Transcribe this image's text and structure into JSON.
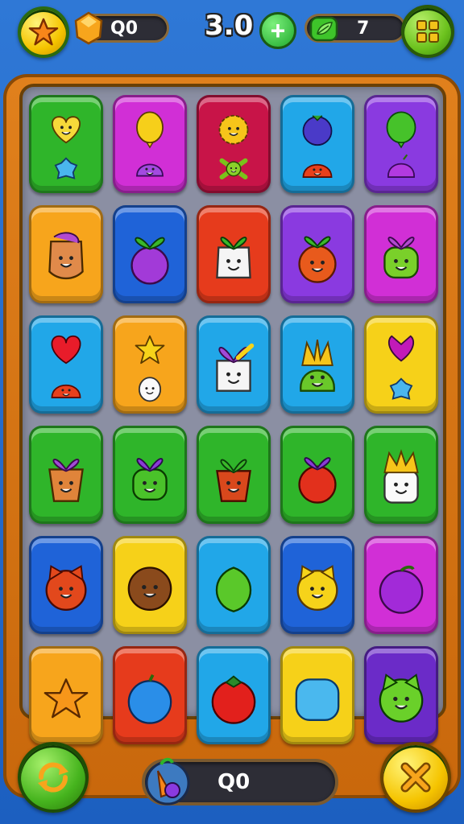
{
  "top_bar": {
    "gem_counter": "Q0",
    "center_value": "3.0",
    "leaf_counter": "7"
  },
  "bottom_bar": {
    "counter": "Q0"
  },
  "colors": {
    "green": "#2fb52a",
    "magenta": "#d12fd6",
    "crimson": "#c81448",
    "sky": "#21a7e8",
    "violet": "#8a3ae0",
    "orange": "#f7a51c",
    "blue": "#1f63d8",
    "yellow": "#f6d119",
    "red": "#e63b1c",
    "purple": "#6b2bc8"
  },
  "board": {
    "rows": [
      [
        {
          "bg": "green",
          "items": [
            "yellow-heart-face",
            "blue-gem"
          ]
        },
        {
          "bg": "magenta",
          "items": [
            "yellow-balloon",
            "purple-slime"
          ]
        },
        {
          "bg": "crimson",
          "items": [
            "yellow-fluffy-face",
            "green-crossbones"
          ]
        },
        {
          "bg": "sky",
          "items": [
            "blue-berry",
            "red-slime"
          ]
        },
        {
          "bg": "violet",
          "items": [
            "green-balloon",
            "purple-fruit"
          ]
        }
      ],
      [
        {
          "bg": "orange",
          "items": [
            "horse-face"
          ]
        },
        {
          "bg": "blue",
          "items": [
            "purple-radish"
          ]
        },
        {
          "bg": "red",
          "items": [
            "white-radish-face"
          ]
        },
        {
          "bg": "violet",
          "items": [
            "orange-carrot-face"
          ]
        },
        {
          "bg": "magenta",
          "items": [
            "green-plant-face"
          ]
        }
      ],
      [
        {
          "bg": "sky",
          "items": [
            "red-heart",
            "red-slime"
          ]
        },
        {
          "bg": "orange",
          "items": [
            "yellow-star",
            "white-egg-face"
          ]
        },
        {
          "bg": "sky",
          "items": [
            "white-leek-face"
          ]
        },
        {
          "bg": "sky",
          "items": [
            "green-pineapple-face"
          ]
        },
        {
          "bg": "yellow",
          "items": [
            "magenta-tulip",
            "blue-gem"
          ]
        }
      ],
      [
        {
          "bg": "green",
          "items": [
            "carrot-face"
          ]
        },
        {
          "bg": "green",
          "items": [
            "green-leaf-face"
          ]
        },
        {
          "bg": "green",
          "items": [
            "red-carrot-face"
          ]
        },
        {
          "bg": "green",
          "items": [
            "red-apple-fruit"
          ]
        },
        {
          "bg": "green",
          "items": [
            "white-crown-face"
          ]
        }
      ],
      [
        {
          "bg": "blue",
          "items": [
            "red-cat-face"
          ]
        },
        {
          "bg": "yellow",
          "items": [
            "brown-coconut-face"
          ]
        },
        {
          "bg": "sky",
          "items": [
            "green-lime"
          ]
        },
        {
          "bg": "blue",
          "items": [
            "yellow-cat-face"
          ]
        },
        {
          "bg": "magenta",
          "items": [
            "purple-plum"
          ]
        }
      ],
      [
        {
          "bg": "orange",
          "items": [
            "orange-star"
          ]
        },
        {
          "bg": "red",
          "items": [
            "blue-apple"
          ]
        },
        {
          "bg": "sky",
          "items": [
            "red-tomato"
          ]
        },
        {
          "bg": "yellow",
          "items": [
            "blue-jelly"
          ]
        },
        {
          "bg": "purple",
          "items": [
            "green-cat-face"
          ]
        }
      ]
    ]
  }
}
